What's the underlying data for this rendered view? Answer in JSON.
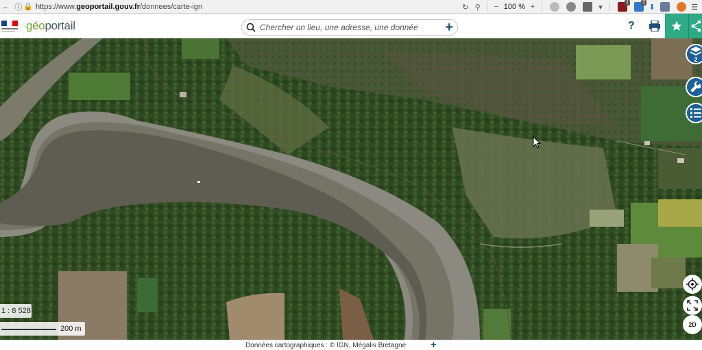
{
  "browser": {
    "url_prefix": "https://www.",
    "url_host": "geoportail.gouv.fr",
    "url_path": "/donnees/carte-ign",
    "zoom": "100 %",
    "badge_1": "1",
    "badge_2": "2"
  },
  "header": {
    "logo_g": "géo",
    "logo_rest": "portail",
    "search_placeholder": "Chercher un lieu, une adresse, une donnée",
    "help_label": "?"
  },
  "map": {
    "scale_ratio": "1 : 8 528",
    "scale_distance": "200 m",
    "layers_count": "2",
    "view_mode": "2D"
  },
  "footer": {
    "credits": "Données cartographiques : ©  IGN,  Mégalis Bretagne"
  },
  "colors": {
    "accent_green": "#2eaa84",
    "tool_blue": "#1f5f95"
  },
  "icons": {
    "search": "search-icon",
    "print": "printer-icon",
    "favorite": "star-icon",
    "share": "share-icon",
    "layers": "layers-icon",
    "tools": "wrench-icon",
    "legend": "list-icon",
    "geolocate": "target-icon",
    "fullscreen": "fullscreen-icon"
  }
}
